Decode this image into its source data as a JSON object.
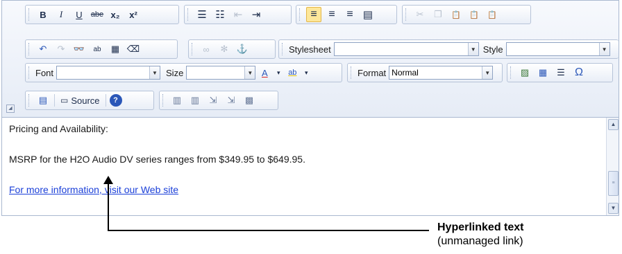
{
  "toolbar": {
    "row1": {
      "format_buttons": [
        {
          "name": "bold",
          "glyph": "B"
        },
        {
          "name": "italic",
          "glyph": "I"
        },
        {
          "name": "underline",
          "glyph": "U"
        },
        {
          "name": "strikethrough",
          "glyph": "abe"
        },
        {
          "name": "subscript",
          "glyph": "x₂"
        },
        {
          "name": "superscript",
          "glyph": "x²"
        }
      ],
      "list_buttons": [
        {
          "name": "numbered-list",
          "glyph": "☰"
        },
        {
          "name": "bulleted-list",
          "glyph": "☷"
        },
        {
          "name": "outdent",
          "glyph": "⇤"
        },
        {
          "name": "indent",
          "glyph": "⇥"
        }
      ],
      "align_buttons": [
        {
          "name": "align-left",
          "glyph": "≡",
          "active": true
        },
        {
          "name": "align-center",
          "glyph": "≡"
        },
        {
          "name": "align-right",
          "glyph": "≡"
        },
        {
          "name": "align-justify",
          "glyph": "▤"
        }
      ],
      "clipboard_buttons": [
        {
          "name": "cut",
          "glyph": "✂"
        },
        {
          "name": "copy",
          "glyph": "❐"
        },
        {
          "name": "paste",
          "glyph": "📋"
        },
        {
          "name": "paste-text",
          "glyph": "📋"
        },
        {
          "name": "paste-word",
          "glyph": "📋"
        }
      ]
    },
    "row2": {
      "stylesheet_label": "Stylesheet",
      "stylesheet_value": "",
      "style_label": "Style",
      "style_value": ""
    },
    "row3": {
      "font_label": "Font",
      "font_value": "",
      "size_label": "Size",
      "size_value": "",
      "text_color_glyph": "A",
      "bg_color_glyph": "ab",
      "format_label": "Format",
      "format_value": "Normal",
      "special_char_glyph": "Ω"
    },
    "row4": {
      "source_label": "Source"
    }
  },
  "content": {
    "line1": "Pricing and Availability:",
    "line2": "MSRP for the H2O Audio DV series ranges from $349.95 to $649.95.",
    "link_text": "For more information, visit our Web site"
  },
  "annotation": {
    "title": "Hyperlinked text",
    "subtitle": "(unmanaged link)"
  },
  "colors": {
    "link": "#1a3fd8",
    "toolbar_bg": "#e6ecf6",
    "border": "#a9b8d0",
    "active_button": "#fde79a"
  }
}
